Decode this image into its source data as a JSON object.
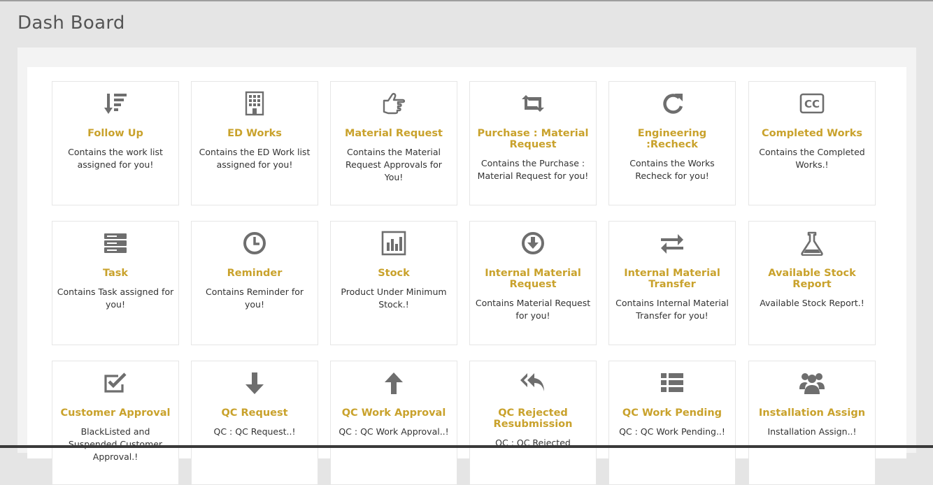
{
  "page": {
    "title": "Dash Board"
  },
  "cards": [
    {
      "icon": "sort-descending-icon",
      "title": "Follow Up",
      "desc": "Contains the work list assigned for you!"
    },
    {
      "icon": "building-icon",
      "title": "ED Works",
      "desc": "Contains the ED Work list assigned for you!"
    },
    {
      "icon": "hand-pointing-icon",
      "title": "Material Request",
      "desc": "Contains the Material Request Approvals for You!"
    },
    {
      "icon": "retweet-icon",
      "title": "Purchase : Material Request",
      "desc": "Contains the Purchase : Material Request for you!"
    },
    {
      "icon": "refresh-icon",
      "title": "Engineering :Recheck",
      "desc": "Contains the Works Recheck for you!"
    },
    {
      "icon": "cc-icon",
      "title": "Completed Works",
      "desc": "Contains the Completed Works.!"
    },
    {
      "icon": "server-icon",
      "title": "Task",
      "desc": "Contains Task assigned for you!"
    },
    {
      "icon": "clock-icon",
      "title": "Reminder",
      "desc": "Contains Reminder for you!"
    },
    {
      "icon": "bar-chart-icon",
      "title": "Stock",
      "desc": "Product Under Minimum Stock.!"
    },
    {
      "icon": "arrow-circle-down-icon",
      "title": "Internal Material Request",
      "desc": "Contains Material Request for you!"
    },
    {
      "icon": "exchange-icon",
      "title": "Internal Material Transfer",
      "desc": "Contains Internal Material Transfer for you!"
    },
    {
      "icon": "flask-icon",
      "title": "Available Stock Report",
      "desc": "Available Stock Report.!"
    },
    {
      "icon": "check-square-icon",
      "title": "Customer Approval",
      "desc": "BlackListed and Suspended Customer Approval.!"
    },
    {
      "icon": "arrow-down-icon",
      "title": "QC Request",
      "desc": "QC : QC Request..!"
    },
    {
      "icon": "arrow-up-icon",
      "title": "QC Work Approval",
      "desc": "QC : QC Work Approval..!"
    },
    {
      "icon": "reply-all-icon",
      "title": "QC Rejected Resubmission",
      "desc": "QC : QC Rejected"
    },
    {
      "icon": "list-icon",
      "title": "QC Work Pending",
      "desc": "QC : QC Work Pending..!"
    },
    {
      "icon": "users-icon",
      "title": "Installation Assign",
      "desc": "Installation Assign..!"
    }
  ],
  "colors": {
    "accent": "#c9a22c",
    "icon": "#6e6e6e",
    "text": "#333333",
    "background": "#e5e5e5"
  }
}
